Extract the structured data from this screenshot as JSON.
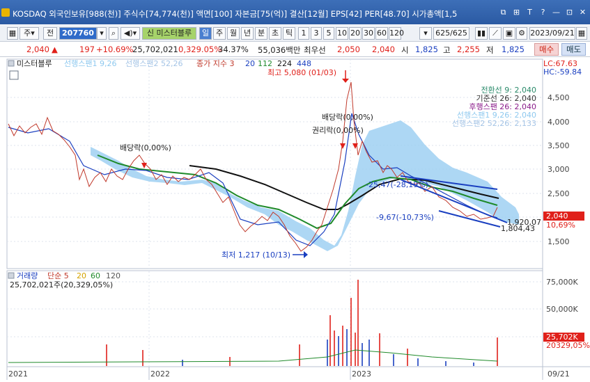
{
  "window": {
    "title": "KOSDAQ 외국인보유[988(천)] 주식수[74,774(천)] 액면[100] 자본금[75(억)] 결산[12월] EPS[42] PER[48.70] 시가총액[1,5",
    "controls": [
      "⧉",
      "⊞",
      "T",
      "?",
      "—",
      "⊡",
      "✕"
    ]
  },
  "toolbar": {
    "type_label": "주",
    "period_label": "전",
    "code": "207760",
    "indicator": "신 미스터블루",
    "freq": [
      "일",
      "주",
      "월",
      "년",
      "분",
      "초",
      "틱"
    ],
    "minutes": [
      "1",
      "3",
      "5",
      "10",
      "20",
      "30",
      "60",
      "120"
    ],
    "count": "625/625",
    "date": "2023/09/21"
  },
  "quote": {
    "price": "2,040",
    "arrow": "▲",
    "change": "197",
    "change_pct": "+10.69%",
    "volume": "25,702,021",
    "vol_ratio": "0,329.05%",
    "turnover": "34.37%",
    "amount": "55,036백만",
    "best_ask_label": "최우선",
    "best_ask": "2,050",
    "best_bid": "2,040",
    "open_label": "시",
    "open": "1,825",
    "high_label": "고",
    "high": "2,255",
    "low_label": "저",
    "low": "1,825",
    "buy_label": "매수",
    "sell_label": "매도"
  },
  "price_panel": {
    "legend_name": "미스터블루",
    "legend_items": [
      {
        "label": "선행스팬1 9,26",
        "color": "#8fc9ef"
      },
      {
        "label": "선행스팬2 52,26",
        "color": "#b8d8f2"
      },
      {
        "label": "종가 지수 3",
        "color": "#c0392b"
      },
      {
        "label": "20",
        "color": "#1a3fc0"
      },
      {
        "label": "112",
        "color": "#1f8a2a"
      },
      {
        "label": "224",
        "color": "#111111"
      },
      {
        "label": "448",
        "color": "#1a3fc0"
      }
    ],
    "lc": "LC:67.63",
    "hc": "HC:-59.84",
    "ichimoku_legend": [
      {
        "label": "전환선 9: 2,040",
        "color": "#2a8a6a"
      },
      {
        "label": "기준선 26: 2,040",
        "color": "#333333"
      },
      {
        "label": "후행스팬 26: 2,040",
        "color": "#8a1a8a"
      },
      {
        "label": "선행스팬1 9,26: 2,040",
        "color": "#8fc9ef"
      },
      {
        "label": "선행스팬2 52,26: 2,133",
        "color": "#a4c4e6"
      }
    ],
    "y_ticks": [
      "4,500",
      "4,000",
      "3,500",
      "3,000",
      "2,500",
      "2,000",
      "1,500"
    ],
    "price_tag": "2,040",
    "pct_tag": "10,69%",
    "annotations": {
      "high": "최고 5,080 (01/03)",
      "low": "최저 1,217 (10/13)",
      "dividend1": "배당락(0,00%)",
      "dividend2": "배당락(0,00%)",
      "rights": "권리락(0,00%)",
      "trend1": "-9,67(-10,73%)",
      "trend2": "-25,47(-28,19%)",
      "line_val1": "1,920,07",
      "line_val2": "1,804,43"
    }
  },
  "volume_panel": {
    "legend_name": "거래량",
    "legend_items": [
      {
        "label": "단순 5",
        "color": "#c0392b"
      },
      {
        "label": "20",
        "color": "#d4a300"
      },
      {
        "label": "60",
        "color": "#1f8a2a"
      },
      {
        "label": "120",
        "color": "#555555"
      }
    ],
    "current": "25,702,021주(20,329,05%)",
    "y_ticks": [
      "75,000K",
      "50,000K"
    ],
    "vol_tag": "25,702K",
    "pct_tag": "20329,05%"
  },
  "x_axis": {
    "labels": [
      "2021",
      "2022",
      "2023",
      "09/21"
    ]
  }
}
